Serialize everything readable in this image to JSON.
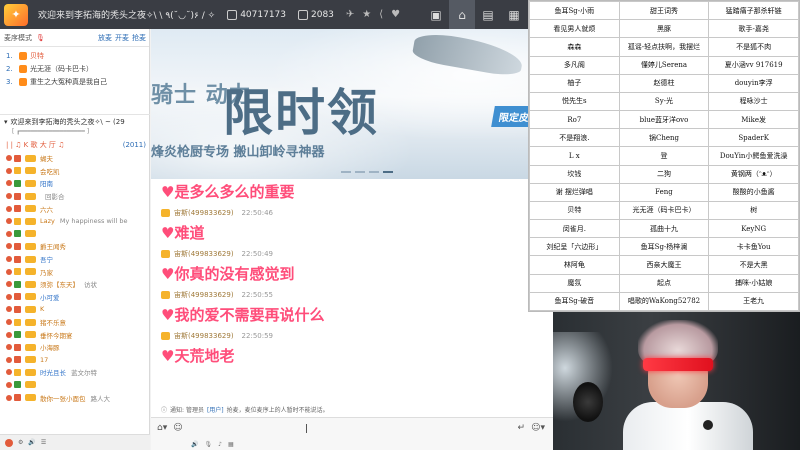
{
  "titlebar": {
    "title": "欢迎来到李拓海的秃头之夜✧\\ \\ ٩(˘◡˘)۶ / ✧",
    "fans": "40717173",
    "online": "2083"
  },
  "left_panel": {
    "mode_label": "麦序模式",
    "actions": [
      "放麦",
      "开麦",
      "抢麦"
    ],
    "queue": [
      {
        "num": "1.",
        "name": "贝特"
      },
      {
        "num": "2.",
        "name": "光无涯（码卡巴卡）"
      },
      {
        "num": "3.",
        "name": "重生之大冤种真是我自己"
      }
    ],
    "channel_title": "欢迎来到李拓海的秃头之夜✧\\ ~ (29",
    "channel_sub": "[ ┏━━━━━━━━━━━━━━━━━━ ]",
    "category": "| | ♫ K 歌 大 厅 ♫",
    "category_count": "(2011)",
    "users": [
      {
        "name": "蝴夫",
        "style": "orange",
        "extra": ""
      },
      {
        "name": "会吃凯",
        "style": "orange",
        "extra": ""
      },
      {
        "name": "阳南",
        "style": "blue",
        "extra": ""
      },
      {
        "name": "",
        "style": "orange",
        "extra": "回影合"
      },
      {
        "name": "六六",
        "style": "orange",
        "extra": ""
      },
      {
        "name": "Lazy",
        "style": "orange",
        "extra": "My happiness will be"
      },
      {
        "name": "",
        "style": "orange",
        "extra": ""
      },
      {
        "name": "爵王闻秀",
        "style": "orange",
        "extra": ""
      },
      {
        "name": "吾宁",
        "style": "blue",
        "extra": ""
      },
      {
        "name": "乃家",
        "style": "orange",
        "extra": ""
      },
      {
        "name": "须弥【东天】",
        "style": "orange",
        "extra": "访状"
      },
      {
        "name": "小可爱",
        "style": "blue",
        "extra": ""
      },
      {
        "name": "K",
        "style": "orange",
        "extra": ""
      },
      {
        "name": "猪不乐意",
        "style": "orange",
        "extra": ""
      },
      {
        "name": "垂怀今期宴",
        "style": "orange",
        "extra": ""
      },
      {
        "name": "小海豚",
        "style": "orange",
        "extra": ""
      },
      {
        "name": "17",
        "style": "orange",
        "extra": ""
      },
      {
        "name": "时光且长",
        "style": "blue",
        "extra": "蓝文尔特"
      },
      {
        "name": "",
        "style": "orange",
        "extra": ""
      },
      {
        "name": "散你一张小面包",
        "style": "orange",
        "extra": "路人大"
      }
    ]
  },
  "banner": {
    "line1": "骑士 动力",
    "line2": "限时领",
    "slogan": "烽炎枪厨专场 搬山卸岭寻神器",
    "tag": "限定皮肤"
  },
  "chat": {
    "messages": [
      {
        "sender": "",
        "time": "",
        "text": "♥是多么多么的重要"
      },
      {
        "sender": "宙斯(499833629)",
        "time": "22:50:46",
        "text": "♥难道"
      },
      {
        "sender": "宙斯(499833629)",
        "time": "22:50:49",
        "text": "♥你真的没有感觉到"
      },
      {
        "sender": "宙斯(499833629)",
        "time": "22:50:55",
        "text": "♥我的爱不需要再说什么"
      },
      {
        "sender": "宙斯(499833629)",
        "time": "22:50:59",
        "text": "♥天荒地老"
      }
    ],
    "notice_prefix": "通知: 管理员",
    "notice_link": "[用户]",
    "notice_suffix": "抢麦，麦位麦序上的人暂时不能说话。"
  },
  "names_grid": [
    [
      "鱼耳Sg-小雨",
      "甜王词秀",
      "猛踏痛子那杀轩链"
    ],
    [
      "看见男人就烦",
      "黑豚",
      "歌手-嘉尧"
    ],
    [
      "森森",
      "孤谣-轻点扶啊，我摆烂",
      "不是狐不肉"
    ],
    [
      "多凡阁",
      "懂婷儿Serena",
      "夏小涵vv 917619"
    ],
    [
      "柚子",
      "赵德柱",
      "douyin李浮"
    ],
    [
      "悦先生s",
      "Sy-光",
      "程咏沙士"
    ],
    [
      "Ro7",
      "blue蓝牙洋ovo",
      "Mike发"
    ],
    [
      "不是翔浪.",
      "锅Cheng",
      "SpaderK"
    ],
    [
      "L x",
      "登",
      "DouYin小鳄鱼爱洗澡"
    ],
    [
      "坎钱",
      "二狗",
      "黄钢两（ᵔᴥᵔ）"
    ],
    [
      "谢 摆烂弹唱",
      "Feng",
      "酸酸的小鱼酱"
    ],
    [
      "贝特",
      "光无涯（码卡巴卡）",
      "树"
    ],
    [
      "闵雀月.",
      "孤曲十九",
      "KeyNG"
    ],
    [
      "刘纪呈「六边形」",
      "鱼耳Sg-杨梓澜",
      "卡卡鱼You"
    ],
    [
      "林阿龟",
      "西亲大魔王",
      "不是大黑"
    ],
    [
      "魔氛",
      "起点",
      "捕咪-小姑娘"
    ],
    [
      "鱼耳Sg-破音",
      "唱歌的WaKong52782",
      "王老九"
    ]
  ],
  "colors": {
    "chat_pink": "#ff4d7a",
    "titlebar": "#3a3d44",
    "link_blue": "#2d6db5"
  }
}
